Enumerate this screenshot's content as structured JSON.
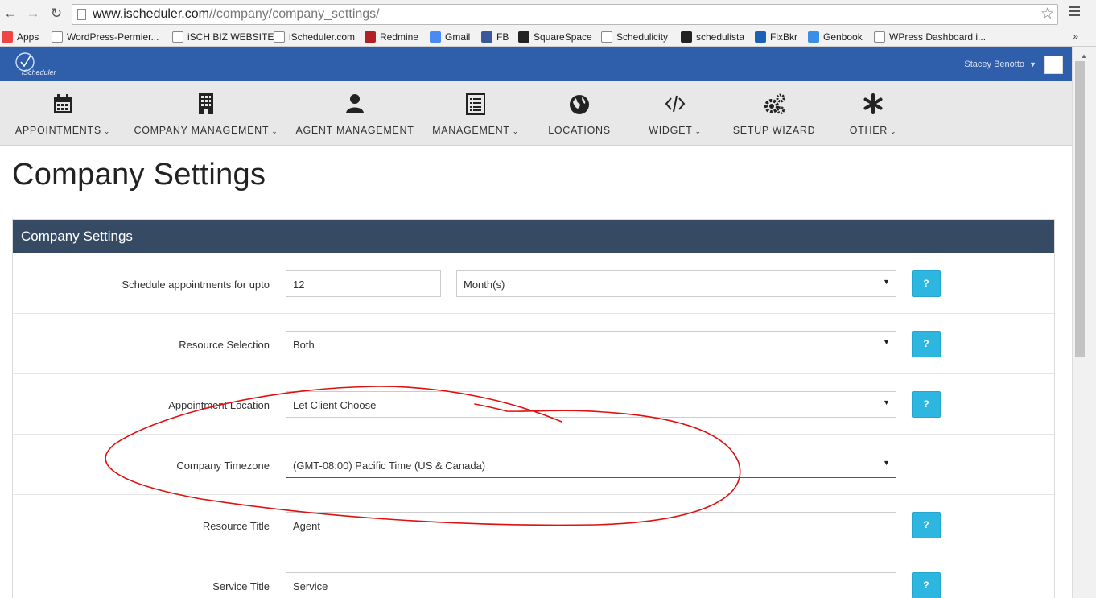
{
  "browser": {
    "url_host": "www.ischeduler.com",
    "url_path": "//company/company_settings/",
    "bookmarks": [
      {
        "label": "Apps",
        "icon": "apps-grid-icon",
        "color": "#e44"
      },
      {
        "label": "WordPress-Permier...",
        "icon": "page-icon",
        "color": "#ffffff"
      },
      {
        "label": "iSCH BIZ WEBSITE",
        "icon": "page-icon",
        "color": "#ffffff"
      },
      {
        "label": "iScheduler.com",
        "icon": "ischeduler-icon",
        "color": "#ffffff"
      },
      {
        "label": "Redmine",
        "icon": "redmine-icon",
        "color": "#b32024"
      },
      {
        "label": "Gmail",
        "icon": "google-icon",
        "color": "#4a8af4"
      },
      {
        "label": "FB",
        "icon": "facebook-icon",
        "color": "#3b5998"
      },
      {
        "label": "SquareSpace",
        "icon": "squarespace-icon",
        "color": "#222222"
      },
      {
        "label": "Schedulicity",
        "icon": "schedulicity-icon",
        "color": "#ffffff"
      },
      {
        "label": "schedulista",
        "icon": "schedulista-icon",
        "color": "#222222"
      },
      {
        "label": "FlxBkr",
        "icon": "flxbkr-icon",
        "color": "#1a5fb4"
      },
      {
        "label": "Genbook",
        "icon": "genbook-icon",
        "color": "#3a8ee6"
      },
      {
        "label": "WPress Dashboard i...",
        "icon": "wordpress-icon",
        "color": "#ffffff"
      }
    ],
    "more": "»"
  },
  "header": {
    "logo_text": "iScheduler",
    "user_name": "Stacey Benotto"
  },
  "nav": [
    {
      "label": "APPOINTMENTS",
      "icon": "calendar-icon",
      "has_caret": true
    },
    {
      "label": "COMPANY MANAGEMENT",
      "icon": "building-icon",
      "has_caret": true
    },
    {
      "label": "AGENT MANAGEMENT",
      "icon": "user-icon",
      "has_caret": false
    },
    {
      "label": "MANAGEMENT",
      "icon": "list-icon",
      "has_caret": true
    },
    {
      "label": "LOCATIONS",
      "icon": "globe-icon",
      "has_caret": false
    },
    {
      "label": "WIDGET",
      "icon": "code-icon",
      "has_caret": true
    },
    {
      "label": "SETUP WIZARD",
      "icon": "gears-icon",
      "has_caret": false
    },
    {
      "label": "OTHER",
      "icon": "asterisk-icon",
      "has_caret": true
    }
  ],
  "page": {
    "title": "Company Settings",
    "panel_title": "Company Settings",
    "help_label": "?",
    "rows": [
      {
        "label": "Schedule appointments for upto",
        "value": "12",
        "unit": "Month(s)"
      },
      {
        "label": "Resource Selection",
        "value": "Both"
      },
      {
        "label": "Appointment Location",
        "value": "Let Client Choose"
      },
      {
        "label": "Company Timezone",
        "value": "(GMT-08:00) Pacific Time (US & Canada)"
      },
      {
        "label": "Resource Title",
        "value": "Agent"
      },
      {
        "label": "Service Title",
        "value": "Service"
      }
    ]
  },
  "colors": {
    "header_bg": "#2f5faa",
    "panel_head_bg": "#364a63",
    "help_button": "#2cb6e0",
    "annotation": "#e01010"
  }
}
